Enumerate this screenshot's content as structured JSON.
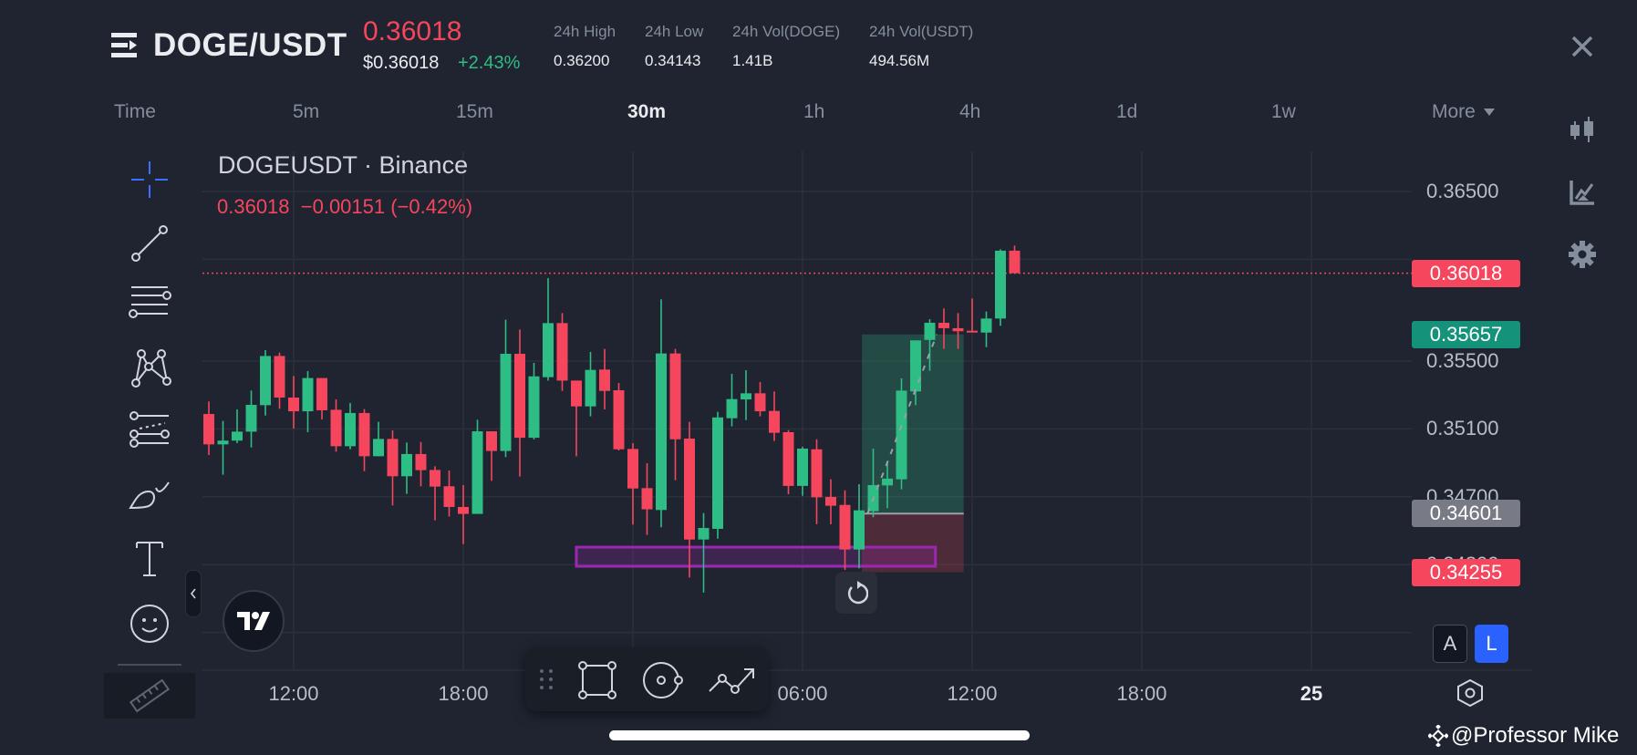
{
  "header": {
    "pair": "DOGE/USDT",
    "last_price": "0.36018",
    "usd_price": "$0.36018",
    "change_pct": "+2.43%",
    "stats": [
      {
        "label": "24h High",
        "value": "0.36200"
      },
      {
        "label": "24h Low",
        "value": "0.34143"
      },
      {
        "label": "24h Vol(DOGE)",
        "value": "1.41B"
      },
      {
        "label": "24h Vol(USDT)",
        "value": "494.56M"
      }
    ]
  },
  "timeframes": {
    "items": [
      "Time",
      "5m",
      "15m",
      "30m",
      "1h",
      "4h",
      "1d",
      "1w",
      "More"
    ],
    "active": "30m"
  },
  "legend": {
    "symbol": "DOGEUSDT · Binance",
    "values": "0.36018  −0.00151 (−0.42%)"
  },
  "buttons": {
    "auto": "A",
    "log": "L"
  },
  "watermark": "@Professor Mike",
  "colors": {
    "up": "#2ebd85",
    "down": "#f6465d",
    "bg": "#1f2430",
    "accent": "#3b6fff",
    "zone": "#9c27b0"
  },
  "chart_data": {
    "type": "candlestick",
    "interval": "30m",
    "ylim": [
      0.3385,
      0.3675
    ],
    "y_ticks": [
      "0.36500",
      "0.35500",
      "0.35100",
      "0.34700",
      "0.34300"
    ],
    "x_ticks": [
      {
        "bar": 6,
        "label": "12:00"
      },
      {
        "bar": 18,
        "label": "18:00"
      },
      {
        "bar": 42,
        "label": "06:00"
      },
      {
        "bar": 54,
        "label": "12:00"
      },
      {
        "bar": 66,
        "label": "18:00"
      },
      {
        "bar": 78,
        "label": "25",
        "bold": true
      }
    ],
    "ohlc": [
      [
        0.35188,
        0.35262,
        0.34946,
        0.35009
      ],
      [
        0.35009,
        0.35147,
        0.3483,
        0.35031
      ],
      [
        0.35031,
        0.35215,
        0.35016,
        0.35084
      ],
      [
        0.35084,
        0.35326,
        0.34991,
        0.35242
      ],
      [
        0.3524,
        0.35565,
        0.35179,
        0.3553
      ],
      [
        0.3553,
        0.3555,
        0.35219,
        0.35285
      ],
      [
        0.35285,
        0.35412,
        0.35102,
        0.35204
      ],
      [
        0.35204,
        0.35441,
        0.35081,
        0.354
      ],
      [
        0.354,
        0.354,
        0.35156,
        0.3521
      ],
      [
        0.35213,
        0.35274,
        0.34966,
        0.34998
      ],
      [
        0.34998,
        0.35253,
        0.3498,
        0.35194
      ],
      [
        0.35194,
        0.35217,
        0.34851,
        0.34939
      ],
      [
        0.34939,
        0.35142,
        0.34939,
        0.35041
      ],
      [
        0.35041,
        0.35091,
        0.34649,
        0.34821
      ],
      [
        0.34821,
        0.3502,
        0.34717,
        0.34952
      ],
      [
        0.34952,
        0.35023,
        0.34762,
        0.34857
      ],
      [
        0.34858,
        0.3488,
        0.34561,
        0.3476
      ],
      [
        0.34762,
        0.34855,
        0.34583,
        0.3464
      ],
      [
        0.3464,
        0.34769,
        0.34421,
        0.34599
      ],
      [
        0.34599,
        0.35154,
        0.34599,
        0.35086
      ],
      [
        0.35086,
        0.35086,
        0.34794,
        0.3497
      ],
      [
        0.3497,
        0.35744,
        0.34934,
        0.35543
      ],
      [
        0.35543,
        0.35686,
        0.34819,
        0.35048
      ],
      [
        0.35048,
        0.35489,
        0.35038,
        0.3541
      ],
      [
        0.35405,
        0.35989,
        0.35385,
        0.35724
      ],
      [
        0.35724,
        0.35783,
        0.35324,
        0.35385
      ],
      [
        0.35385,
        0.35385,
        0.34939,
        0.35233
      ],
      [
        0.35233,
        0.35554,
        0.35174,
        0.35448
      ],
      [
        0.3545,
        0.35572,
        0.35215,
        0.35324
      ],
      [
        0.35328,
        0.35371,
        0.34973,
        0.3498
      ],
      [
        0.34982,
        0.35016,
        0.34536,
        0.34749
      ],
      [
        0.34751,
        0.34898,
        0.34475,
        0.34626
      ],
      [
        0.34622,
        0.35864,
        0.3452,
        0.35545
      ],
      [
        0.35545,
        0.35572,
        0.34798,
        0.35039
      ],
      [
        0.35043,
        0.35142,
        0.34224,
        0.34448
      ],
      [
        0.34448,
        0.34604,
        0.34135,
        0.34516
      ],
      [
        0.34511,
        0.35201,
        0.34453,
        0.35168
      ],
      [
        0.35163,
        0.35425,
        0.35115,
        0.35276
      ],
      [
        0.35274,
        0.35446,
        0.35152,
        0.3531
      ],
      [
        0.3531,
        0.35376,
        0.35174,
        0.35204
      ],
      [
        0.35206,
        0.35321,
        0.35029,
        0.35077
      ],
      [
        0.35081,
        0.35093,
        0.34715,
        0.34764
      ],
      [
        0.34764,
        0.34995,
        0.34706,
        0.34984
      ],
      [
        0.3498,
        0.35039,
        0.34538,
        0.34697
      ],
      [
        0.34699,
        0.34803,
        0.34538,
        0.34647
      ],
      [
        0.34652,
        0.34738,
        0.34269,
        0.34389
      ],
      [
        0.34389,
        0.34774,
        0.34278,
        0.3462
      ],
      [
        0.34615,
        0.34984,
        0.34579,
        0.34769
      ],
      [
        0.34767,
        0.349,
        0.34633,
        0.34807
      ],
      [
        0.34803,
        0.35398,
        0.34744,
        0.35326
      ],
      [
        0.35321,
        0.35622,
        0.3524,
        0.35622
      ],
      [
        0.35625,
        0.35747,
        0.35443,
        0.35726
      ],
      [
        0.35726,
        0.3581,
        0.35572,
        0.35694
      ],
      [
        0.35694,
        0.35783,
        0.35572,
        0.35676
      ],
      [
        0.35679,
        0.35869,
        0.35672,
        0.35672
      ],
      [
        0.35668,
        0.35792,
        0.35582,
        0.35751
      ],
      [
        0.35751,
        0.36159,
        0.35708,
        0.36151
      ],
      [
        0.36151,
        0.36181,
        0.36018,
        0.36018
      ]
    ],
    "last_price": {
      "value": 0.36018,
      "label": "0.36018"
    },
    "long_position": {
      "start_bar": 46.2,
      "end_bar": 53.4,
      "target": 0.35657,
      "target_label": "0.35657",
      "entry": 0.34601,
      "entry_label": "0.34601",
      "stop": 0.34255,
      "stop_label": "0.34255"
    },
    "zone_rect": {
      "start_bar": 26,
      "end_bar": 51.4,
      "top": 0.34403,
      "bottom": 0.3429
    }
  }
}
